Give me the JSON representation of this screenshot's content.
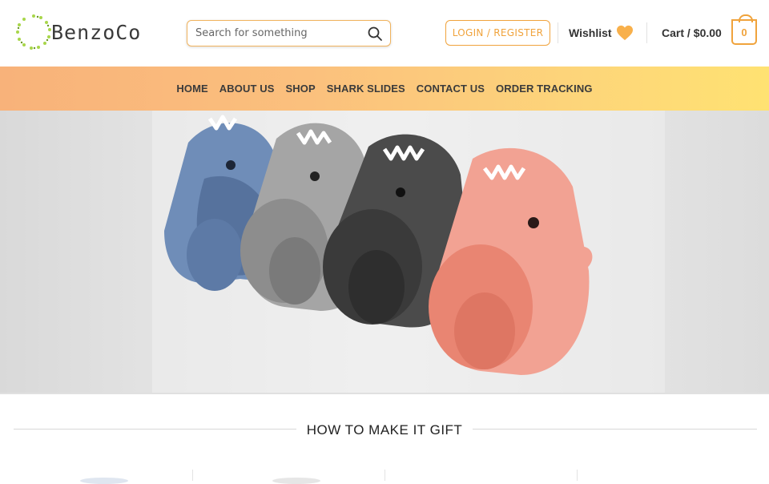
{
  "brand": {
    "name": "BenzoCo",
    "accent": "#f0a33c",
    "logo_dot_color": "#a8d64a"
  },
  "search": {
    "placeholder": "Search for something",
    "icon": "search-icon"
  },
  "account": {
    "login_label": "LOGIN  /  REGISTER"
  },
  "wishlist": {
    "label": "Wishlist",
    "icon": "heart-icon",
    "icon_color": "#f8b04b"
  },
  "cart": {
    "label": "Cart /",
    "amount": "$0.00",
    "count": "0",
    "icon": "bag-icon"
  },
  "nav": {
    "items": [
      {
        "label": "HOME"
      },
      {
        "label": "ABOUT US"
      },
      {
        "label": "SHOP"
      },
      {
        "label": "SHARK SLIDES"
      },
      {
        "label": "CONTACT US"
      },
      {
        "label": "ORDER TRACKING"
      }
    ]
  },
  "hero": {
    "slides": [
      {
        "color": "#6f8db8"
      },
      {
        "color": "#a5a5a5"
      },
      {
        "color": "#4b4b4b"
      },
      {
        "color": "#f2a293"
      }
    ]
  },
  "section": {
    "heading": "HOW TO MAKE IT GIFT"
  }
}
